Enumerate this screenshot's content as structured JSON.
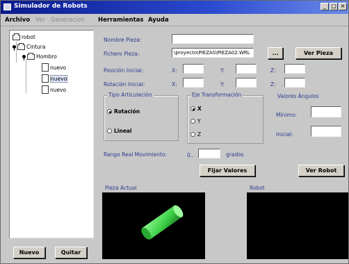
{
  "window": {
    "title": "Simulador de Robots"
  },
  "menubar": {
    "items": [
      {
        "label": "Archivo",
        "enabled": true
      },
      {
        "label": "Ver",
        "enabled": false
      },
      {
        "label": "Generacion",
        "enabled": false
      },
      {
        "label": "Herramientas",
        "enabled": true
      },
      {
        "label": "Ayuda",
        "enabled": true
      }
    ]
  },
  "tree": {
    "root": "robot",
    "child1": "Cintura",
    "child2": "Hombro",
    "leaves": [
      "nuevo",
      "nuevo",
      "nuevo"
    ]
  },
  "tree_buttons": {
    "new_label": "Nuevo",
    "remove_label": "Quitar"
  },
  "form": {
    "nombre_label": "Nombre Pieza:",
    "nombre_value": "",
    "fichero_label": "Fichero Pieza:",
    "fichero_value": "\\proyecto\\PIEZAS\\PIEZA02.WRL",
    "browse_label": "...",
    "ver_pieza_label": "Ver Pieza",
    "pos_label": "Posición Inicial:",
    "rot_label": "Rotación Inicial:",
    "axis_x": "X:",
    "axis_y": "Y:",
    "axis_z": "Z:",
    "pos_x": "",
    "pos_y": "",
    "pos_z": "",
    "rot_x": "",
    "rot_y": "",
    "rot_z": ""
  },
  "articulation": {
    "title": "Tipo Articulación",
    "options": [
      "Rotación",
      "Lineal"
    ],
    "selected": 0
  },
  "axis_group": {
    "title": "Eje Transformación",
    "options": [
      "X",
      "Y",
      "Z"
    ],
    "selected": 0
  },
  "values_group": {
    "title": "Valores Ángulos",
    "min_label": "Mínimo:",
    "init_label": "Inicial:",
    "min_value": "",
    "init_value": ""
  },
  "range": {
    "label": "Rango Real Movimiento:",
    "prefix": "0..",
    "value": "",
    "unit": "grados"
  },
  "actions": {
    "fix_label": "Fijar Valores",
    "ver_robot_label": "Ver Robot"
  },
  "views": {
    "piece_title": "Pieza Actual",
    "robot_title": "Robot"
  },
  "colors": {
    "piece": "#52e85a",
    "title_bar": "#0a1a8c"
  }
}
